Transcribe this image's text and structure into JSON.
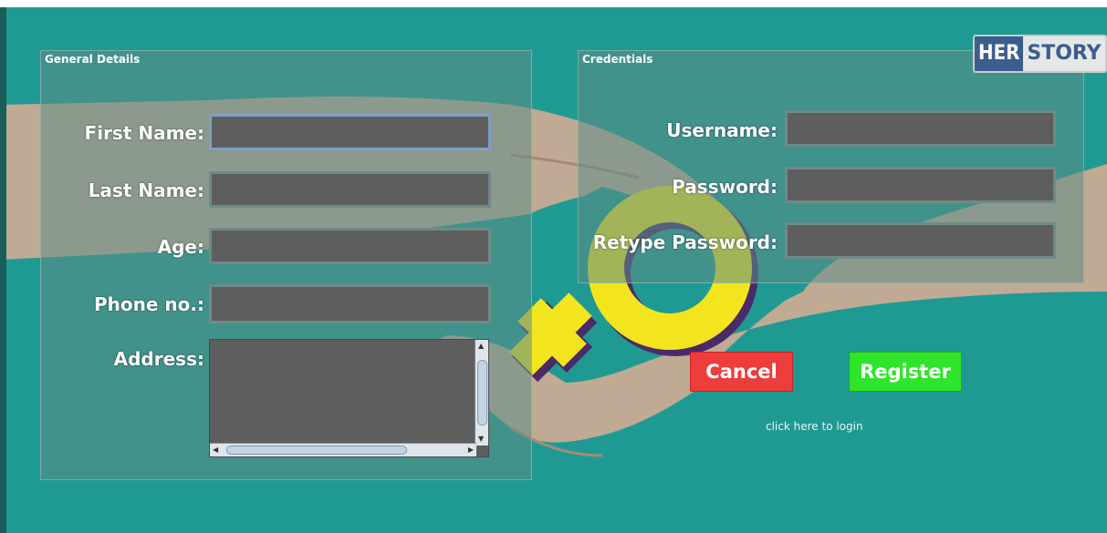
{
  "logo": {
    "part1": "HER",
    "part2": "STORY"
  },
  "general": {
    "title": "General Details",
    "first_name_label": "First Name:",
    "first_name_value": "",
    "last_name_label": "Last Name:",
    "last_name_value": "",
    "age_label": "Age:",
    "age_value": "",
    "phone_label": "Phone no.:",
    "phone_value": "",
    "address_label": "Address:",
    "address_value": ""
  },
  "credentials": {
    "title": "Credentials",
    "username_label": "Username:",
    "username_value": "",
    "password_label": "Password:",
    "password_value": "",
    "retype_label": "Retype Password:",
    "retype_value": ""
  },
  "actions": {
    "cancel_label": "Cancel",
    "register_label": "Register",
    "login_link": "click here to login"
  },
  "colors": {
    "background": "#1f9a93",
    "cancel": "#ee3d3d",
    "register": "#2fe42a",
    "female_symbol": "#f2e51e"
  },
  "icons": [
    "female-symbol-icon",
    "hands-illustration"
  ]
}
